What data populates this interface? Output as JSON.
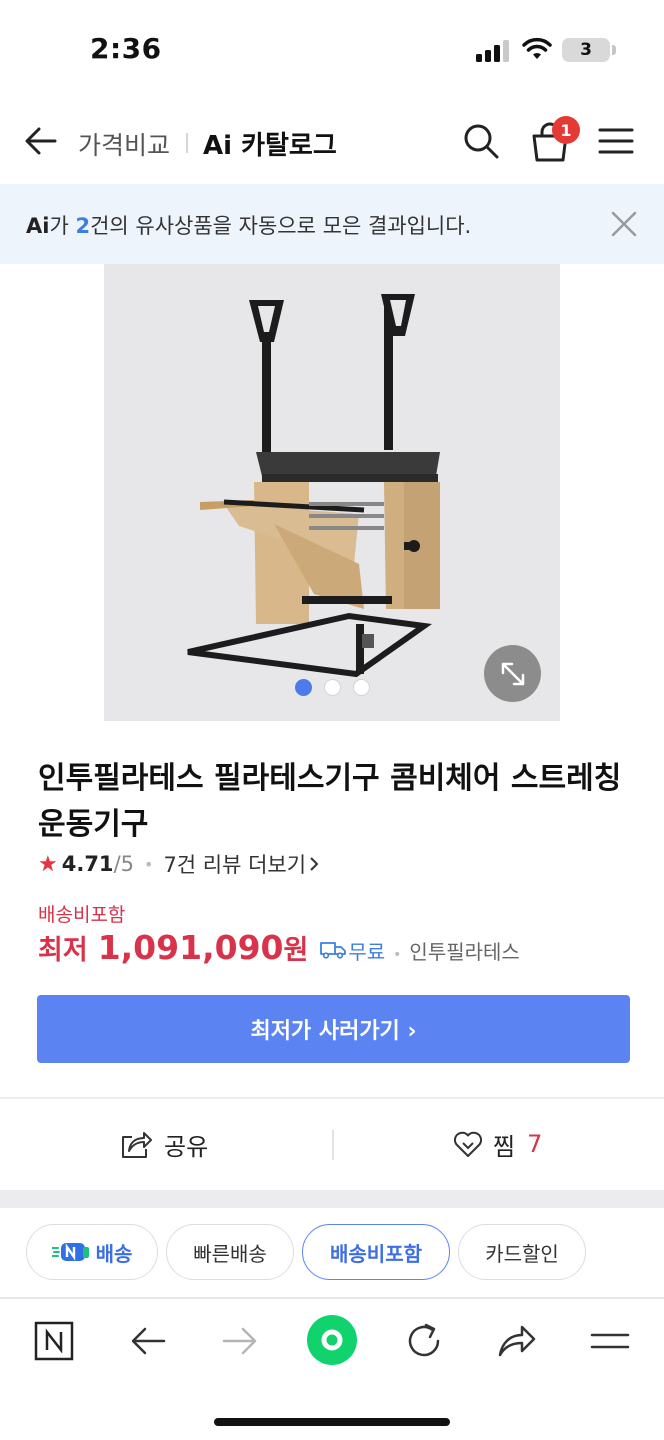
{
  "status_bar": {
    "time": "2:36",
    "battery": "3"
  },
  "header": {
    "compare_label": "가격비교",
    "catalog_label": "Ai 카탈로그",
    "cart_count": "1"
  },
  "ai_banner": {
    "logo": "Ai",
    "text_before": "가 ",
    "count": "2",
    "text_after": "건의 유사상품을 자동으로 모은 결과입니다."
  },
  "product": {
    "title": "인투필라테스 필라테스기구 콤비체어 스트레칭 운동기구",
    "rating": "4.71",
    "rating_max": "/5",
    "review_link": "7건 리뷰 더보기",
    "shipping_label": "배송비포함",
    "price_prefix": "최저",
    "price": "1,091,090",
    "price_unit": "원",
    "free_shipping": "무료",
    "seller": "인투필라테스",
    "image_dots": [
      true,
      false,
      false
    ]
  },
  "buy_button": "최저가 사러가기 ›",
  "actions": {
    "share": "공유",
    "like": "찜",
    "like_count": "7"
  },
  "chips": [
    {
      "label": "배송",
      "icon": "n-delivery-icon"
    },
    {
      "label": "빠른배송"
    },
    {
      "label": "배송비포함",
      "selected": true
    },
    {
      "label": "카드할인"
    }
  ],
  "browser_bar": [
    "naver-home-icon",
    "back-icon",
    "forward-icon",
    "green-dot-icon",
    "refresh-icon",
    "share-icon",
    "menu-icon"
  ],
  "colors": {
    "accent": "#5b84f2",
    "price": "#d8334a",
    "banner_bg": "#eef4fb"
  }
}
